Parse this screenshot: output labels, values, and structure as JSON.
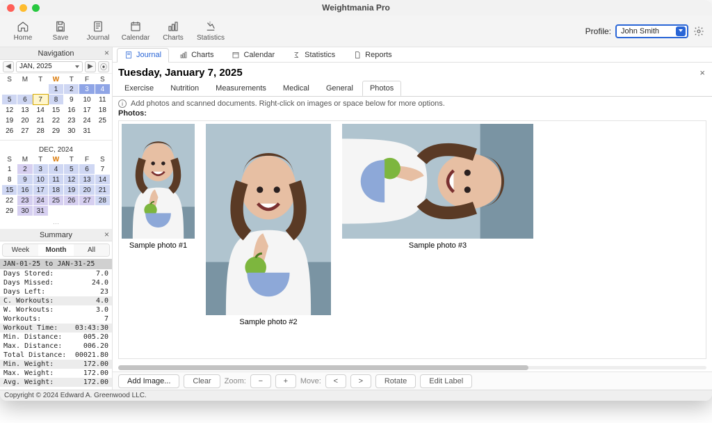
{
  "app": {
    "title": "Weightmania Pro"
  },
  "toolbar": {
    "home": "Home",
    "save": "Save",
    "journal": "Journal",
    "calendar": "Calendar",
    "charts": "Charts",
    "statistics": "Statistics"
  },
  "profile": {
    "label": "Profile:",
    "value": "John Smith"
  },
  "navigation": {
    "title": "Navigation",
    "month_selector": "JAN, 2025",
    "cal1": {
      "dow": [
        "S",
        "M",
        "T",
        "W",
        "T",
        "F",
        "S"
      ]
    },
    "cal2": {
      "title": "DEC, 2024",
      "dow": [
        "S",
        "M",
        "T",
        "W",
        "T",
        "F",
        "S"
      ]
    }
  },
  "summary": {
    "title": "Summary",
    "tabs": {
      "week": "Week",
      "month": "Month",
      "all": "All"
    },
    "range": "JAN-01-25 to JAN-31-25",
    "rows": [
      {
        "label": "Days Stored:",
        "value": "7.0"
      },
      {
        "label": "Days Missed:",
        "value": "24.0"
      },
      {
        "label": "Days Left:",
        "value": "23"
      },
      {
        "label": "C. Workouts:",
        "value": "4.0",
        "band": true
      },
      {
        "label": "W. Workouts:",
        "value": "3.0"
      },
      {
        "label": "Workouts:",
        "value": "7"
      },
      {
        "label": "Workout Time:",
        "value": "03:43:30",
        "band": true
      },
      {
        "label": "Min. Distance:",
        "value": "005.20"
      },
      {
        "label": "Max. Distance:",
        "value": "006.20"
      },
      {
        "label": "Total Distance:",
        "value": "00021.80"
      },
      {
        "label": "Min. Weight:",
        "value": "172.00",
        "band": true
      },
      {
        "label": "Max. Weight:",
        "value": "172.00"
      },
      {
        "label": "Avg. Weight:",
        "value": "172.00",
        "band": true
      }
    ]
  },
  "main_tabs": {
    "journal": "Journal",
    "charts": "Charts",
    "calendar": "Calendar",
    "statistics": "Statistics",
    "reports": "Reports"
  },
  "page": {
    "heading": "Tuesday, January 7, 2025",
    "subtabs": {
      "exercise": "Exercise",
      "nutrition": "Nutrition",
      "measurements": "Measurements",
      "medical": "Medical",
      "general": "General",
      "photos": "Photos"
    },
    "info": "Add photos and scanned documents. Right-click on images or space below for more options.",
    "photos_label": "Photos:",
    "captions": [
      "Sample photo #1",
      "Sample photo #2",
      "Sample photo #3"
    ]
  },
  "actions": {
    "add_image": "Add Image...",
    "clear": "Clear",
    "zoom_label": "Zoom:",
    "minus": "−",
    "plus": "+",
    "move_label": "Move:",
    "left": "<",
    "right": ">",
    "rotate": "Rotate",
    "edit_label": "Edit Label"
  },
  "footer": "Copyright © 2024 Edward A. Greenwood LLC."
}
